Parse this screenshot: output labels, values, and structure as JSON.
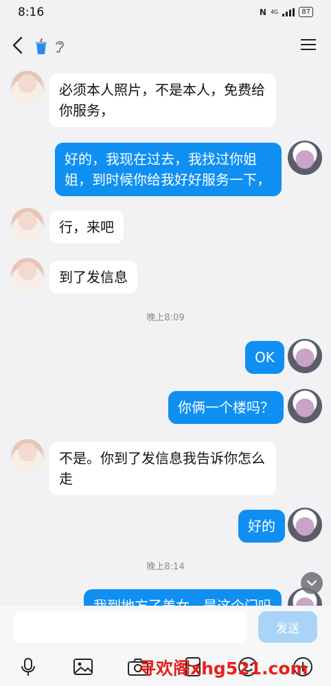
{
  "status_bar": {
    "time": "8:16",
    "network": "4G",
    "battery": "87"
  },
  "header": {
    "back_icon": "chevron-left-icon",
    "cup_icon": "cup-icon",
    "ear_icon": "ear-icon",
    "menu_icon": "menu-icon"
  },
  "messages": [
    {
      "side": "left",
      "text": "必须本人照片，不是本人，免费给你服务，"
    },
    {
      "side": "right",
      "text": "好的，我现在过去，我找过你姐姐，到时候你给我好好服务一下，"
    },
    {
      "side": "left",
      "text": "行，来吧"
    },
    {
      "side": "left",
      "text": "到了发信息"
    },
    {
      "side": "right",
      "text": "OK"
    },
    {
      "side": "right",
      "text": "你俩一个楼吗？"
    },
    {
      "side": "left",
      "text": "不是。你到了发信息我告诉你怎么走"
    },
    {
      "side": "right",
      "text": "好的"
    },
    {
      "side": "right",
      "text": "我到地方了美女，是这个门吗"
    }
  ],
  "timestamps": [
    "晚上8:09",
    "晚上8:14"
  ],
  "input": {
    "placeholder": "",
    "send_label": "发送"
  },
  "toolbar": [
    "mic-icon",
    "image-icon",
    "camera-icon",
    "red-packet-icon",
    "emoji-icon",
    "plus-icon"
  ],
  "watermark": "寻欢阁xhg521.com",
  "colors": {
    "accent": "#0f8ff2",
    "send_disabled": "#a9d4f7",
    "background": "#f2f2f4"
  }
}
